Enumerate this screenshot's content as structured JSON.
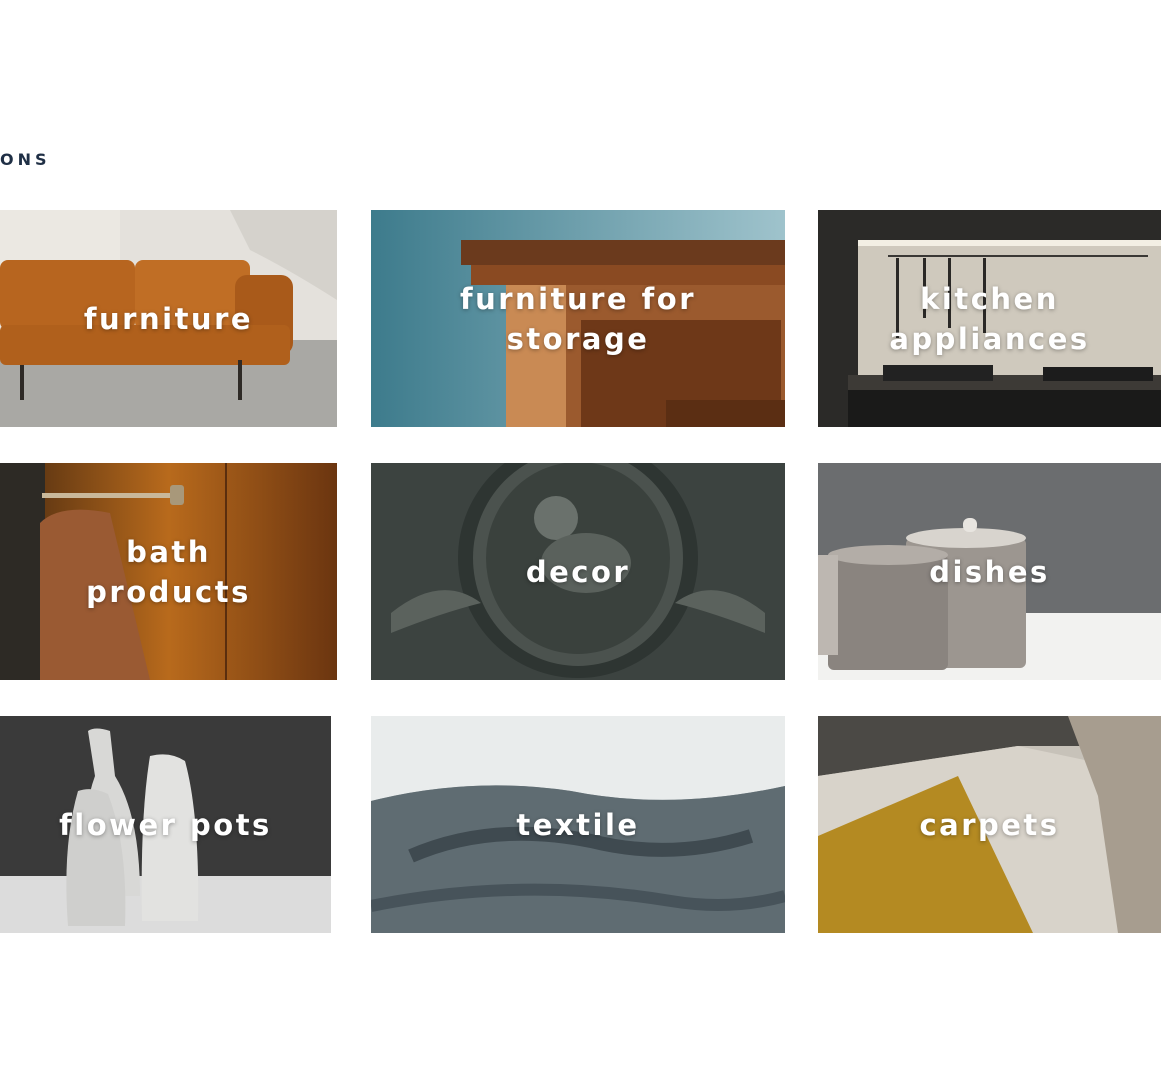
{
  "section": {
    "heading": "ONS"
  },
  "categories": [
    {
      "label": "furniture",
      "icon": "sofa-photo"
    },
    {
      "label": "furniture for storage",
      "icon": "wardrobe-photo"
    },
    {
      "label": "kitchen appliances",
      "icon": "kitchen-photo"
    },
    {
      "label": "bath products",
      "icon": "towel-rail-photo"
    },
    {
      "label": "decor",
      "icon": "ornament-photo"
    },
    {
      "label": "dishes",
      "icon": "jars-photo"
    },
    {
      "label": "flower pots",
      "icon": "vases-photo"
    },
    {
      "label": "textile",
      "icon": "bedding-photo"
    },
    {
      "label": "carpets",
      "icon": "doormat-photo"
    }
  ]
}
